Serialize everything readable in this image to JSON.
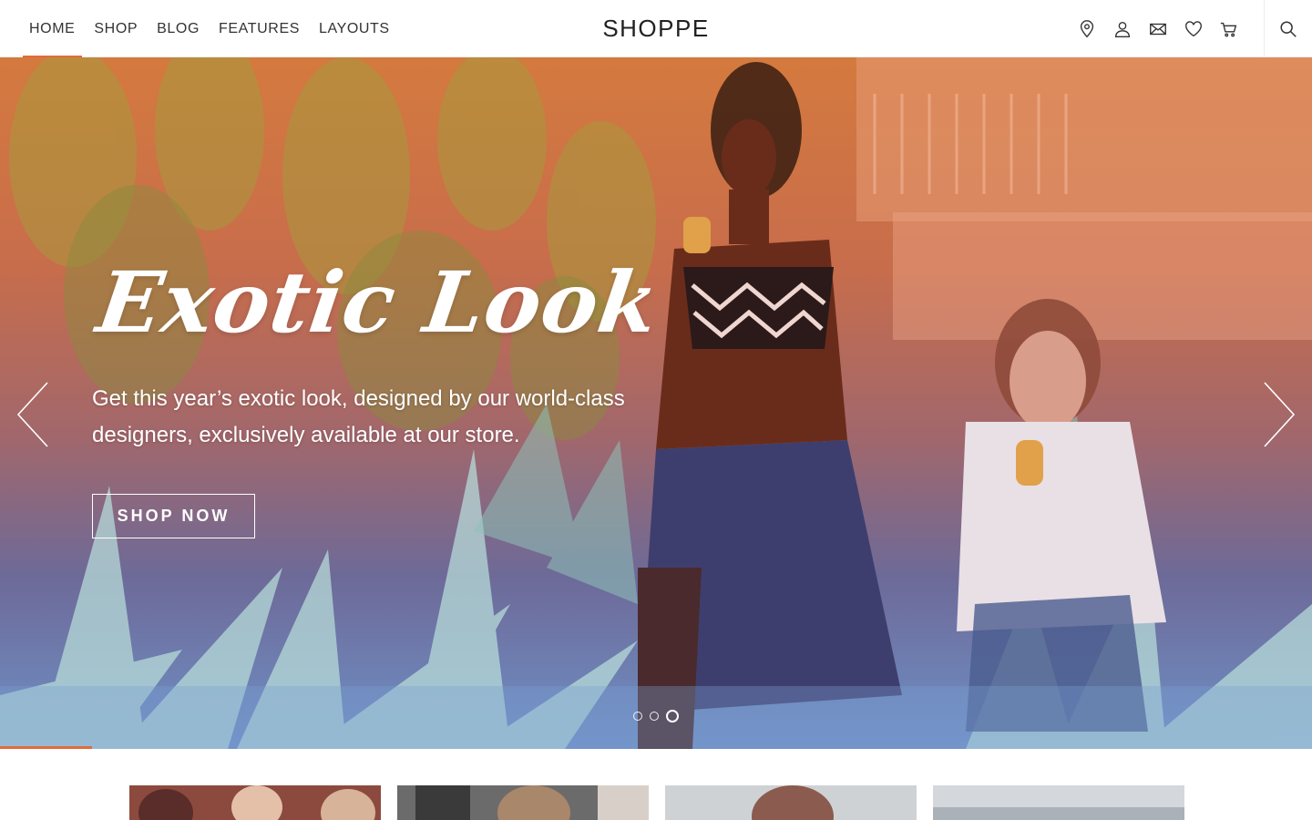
{
  "nav": {
    "items": [
      {
        "label": "HOME",
        "active": true
      },
      {
        "label": "SHOP"
      },
      {
        "label": "BLOG"
      },
      {
        "label": "FEATURES"
      },
      {
        "label": "LAYOUTS"
      }
    ]
  },
  "brand": "SHOPPE",
  "header_icons": [
    "map-pin-icon",
    "user-icon",
    "mail-icon",
    "heart-icon",
    "cart-icon",
    "search-icon"
  ],
  "hero": {
    "title": "Exotic Look",
    "subtitle": "Get this year’s exotic look, designed by our world-class designers, exclusively available at our store.",
    "cta_label": "SHOP NOW",
    "slides_total": 3,
    "active_slide": 3,
    "slide_progress": 0.07
  },
  "colors": {
    "accent": "#e36b3c",
    "text": "#222222",
    "hero_top": "#d47a3e",
    "hero_bottom": "#6f90c6"
  }
}
